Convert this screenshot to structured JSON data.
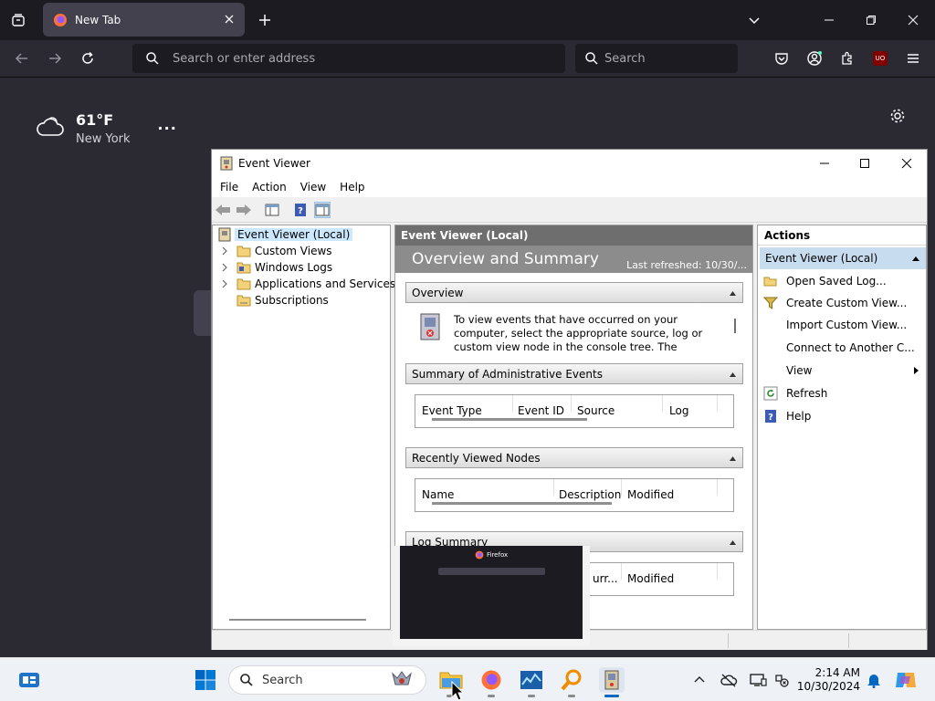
{
  "browser": {
    "tab_title": "New Tab",
    "url_placeholder": "Search or enter address",
    "search_placeholder": "Search",
    "ext_badge": "UO"
  },
  "weather": {
    "temp": "61°F",
    "city": "New York",
    "more": "..."
  },
  "event_viewer": {
    "window_title": "Event Viewer",
    "menu": [
      "File",
      "Action",
      "View",
      "Help"
    ],
    "tree": [
      {
        "label": "Event Viewer (Local)",
        "selected": true
      },
      {
        "label": "Custom Views"
      },
      {
        "label": "Windows Logs"
      },
      {
        "label": "Applications and Services Lo"
      },
      {
        "label": "Subscriptions"
      }
    ],
    "center": {
      "header": "Event Viewer (Local)",
      "title": "Overview and Summary",
      "last_refreshed": "Last refreshed: 10/30/...",
      "sections": {
        "overview": "Overview",
        "summary": "Summary of Administrative Events",
        "recent": "Recently Viewed Nodes",
        "log_summary": "Log Summary"
      },
      "overview_text": "To view events that have occurred on your computer, select the appropriate source, log or custom view node in the console tree. The Administrative Events",
      "summary_cols": [
        "Event Type",
        "Event ID",
        "Source",
        "Log"
      ],
      "recent_cols": [
        "Name",
        "Description",
        "Modified"
      ],
      "log_cols": [
        "urr...",
        "Modified"
      ]
    },
    "actions": {
      "header": "Actions",
      "selected": "Event Viewer (Local)",
      "items": [
        "Open Saved Log...",
        "Create Custom View...",
        "Import Custom View...",
        "Connect to Another C...",
        "View",
        "Refresh",
        "Help"
      ]
    }
  },
  "popup": {
    "label": "Firefox"
  },
  "taskbar": {
    "search_placeholder": "Search",
    "time": "2:14 AM",
    "date": "10/30/2024"
  },
  "colors": {
    "firefox_bg": "#2b2a33",
    "tabbar": "#1c1b22",
    "accent_blue": "#0067c0"
  }
}
